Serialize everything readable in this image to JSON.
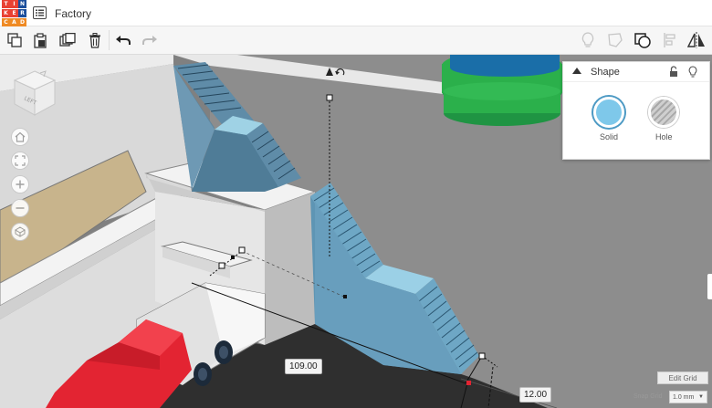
{
  "app": {
    "logo_letters": [
      "T",
      "I",
      "N",
      "K",
      "E",
      "R",
      "C",
      "A",
      "D"
    ],
    "logo_colors": [
      "#e94133",
      "#e94133",
      "#1c4f9c",
      "#e94133",
      "#e94133",
      "#1c4f9c",
      "#ef8a23",
      "#ef8a23",
      "#ef8a23"
    ],
    "project_title": "Factory"
  },
  "toolbar": {
    "left_icons": [
      "copy-icon",
      "paste-icon",
      "duplicate-icon",
      "trash-icon",
      "undo-icon",
      "redo-icon"
    ],
    "right_icons": [
      "lightbulb-icon",
      "note-icon",
      "ruler-icon",
      "align-icon",
      "mirror-icon"
    ]
  },
  "viewcube": {
    "face_label": "LEFT"
  },
  "view_controls": [
    "home-icon",
    "fit-icon",
    "zoom-in-icon",
    "zoom-out-icon",
    "perspective-icon"
  ],
  "shape_panel": {
    "title": "Shape",
    "options": [
      {
        "label": "Solid",
        "color": "#7ec8ea"
      },
      {
        "label": "Hole",
        "color": "#c0c0c0"
      }
    ]
  },
  "dimensions": {
    "length": "109.00",
    "width": "12.00"
  },
  "workplane": {
    "edit_grid_label": "Edit Grid",
    "snap_grid_label": "Snap Grid",
    "snap_grid_value": "1.0 mm"
  },
  "colors": {
    "stair_blue": "#8ecbe2",
    "truck_red": "#e32432",
    "cylinder_green": "#2bb04b",
    "cylinder_blue": "#1a6ea8"
  }
}
